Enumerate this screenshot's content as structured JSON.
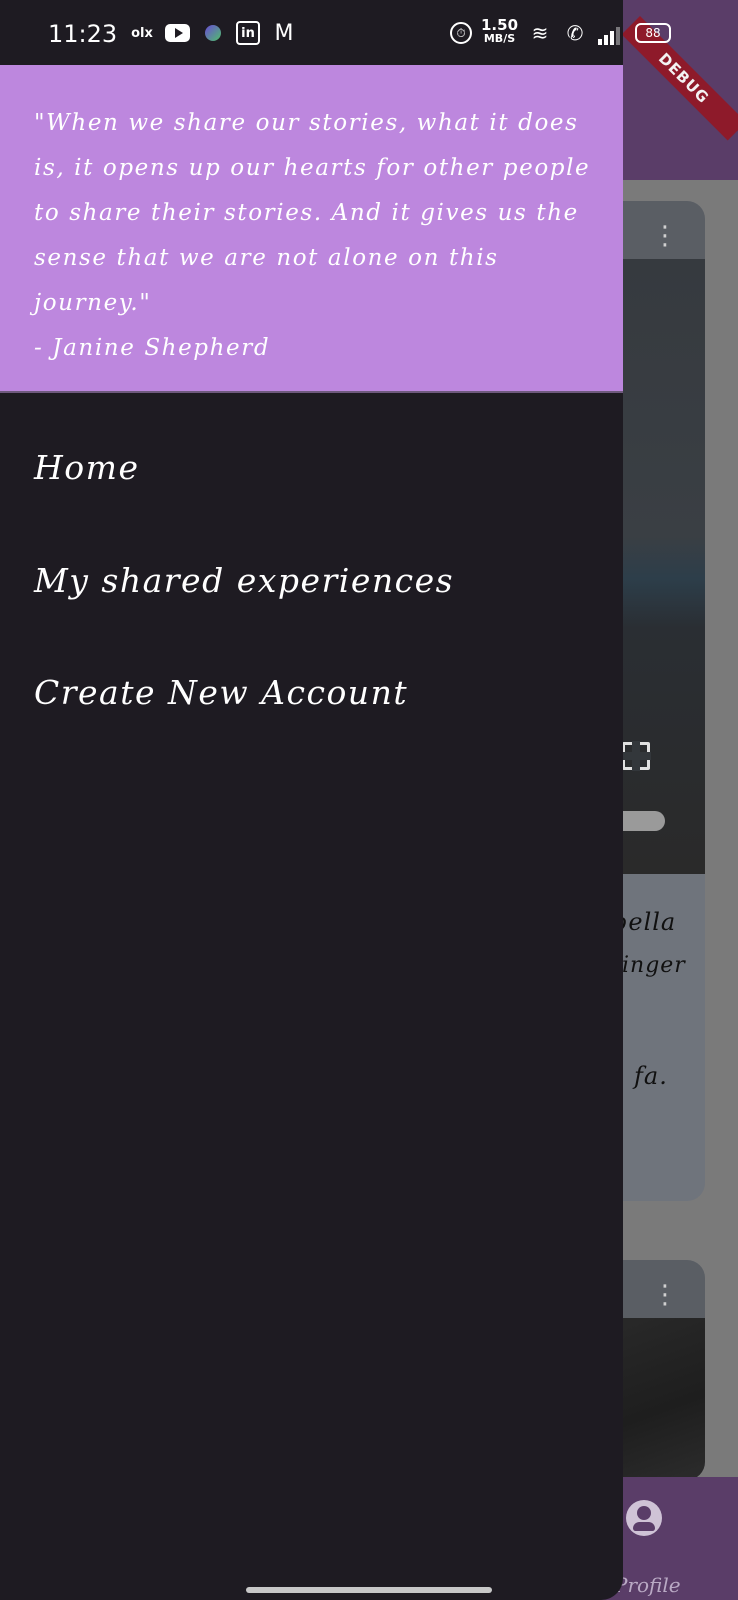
{
  "status_bar": {
    "time": "11:23",
    "notification_icons": [
      "olx-icon",
      "youtube-icon",
      "leaf-app-icon",
      "linkedin-icon",
      "gmail-icon"
    ],
    "olx_text": "olx",
    "linkedin_text": "in",
    "gmail_text": "M",
    "network_speed_value": "1.50",
    "network_speed_unit": "MB/S",
    "battery": "88"
  },
  "debug_banner": "DEBUG",
  "drawer": {
    "quote": "\"When we share our stories, what it does\nis, it opens up our hearts for other people\nto share their stories. And it gives us the\nsense that we are not alone on this journey.\"\n - Janine Shepherd",
    "menu_items": [
      {
        "label": "Home"
      },
      {
        "label": "My shared experiences"
      },
      {
        "label": "Create New Account"
      }
    ]
  },
  "background": {
    "card_text_lines": [
      "bella",
      "inger",
      "fa."
    ],
    "bottom_nav_profile_label": "Profile"
  },
  "colors": {
    "drawer_header": "#bd87de",
    "drawer_bg": "#1e1b22",
    "app_bar": "#5a3d68",
    "debug_ribbon": "#8e1a2a"
  }
}
